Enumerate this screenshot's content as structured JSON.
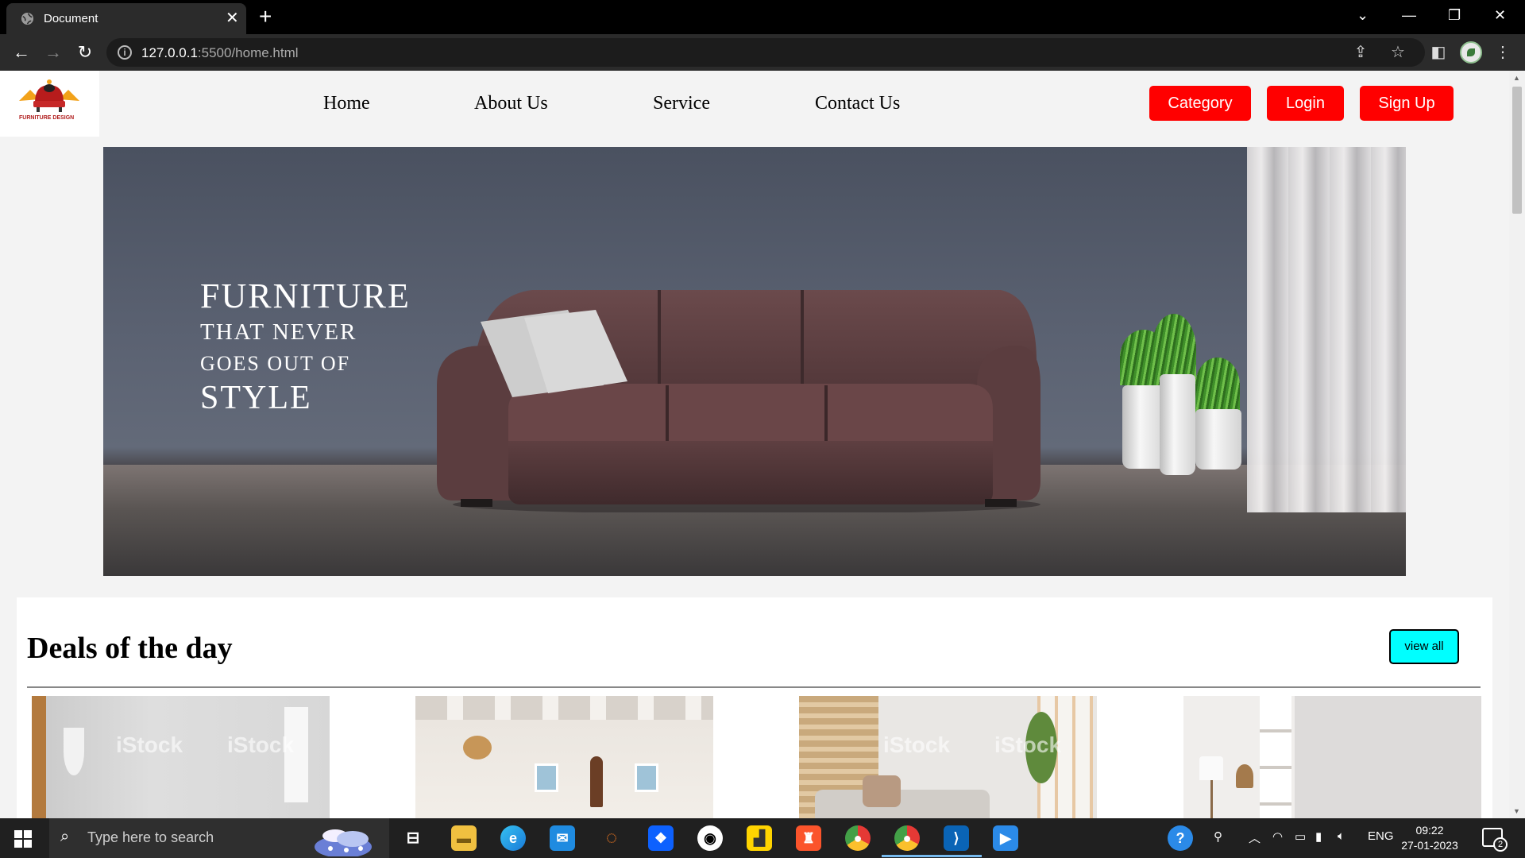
{
  "browser": {
    "tab_title": "Document",
    "tab_close": "✕",
    "new_tab": "+",
    "url_host": "127.0.0.1",
    "url_path": ":5500/home.html",
    "window_controls": [
      "⌄",
      "—",
      "❐",
      "✕"
    ]
  },
  "site": {
    "logo_text": "FURNITURE DESIGN",
    "nav": [
      "Home",
      "About Us",
      "Service",
      "Contact Us"
    ],
    "buttons": {
      "category": "Category",
      "login": "Login",
      "signup": "Sign Up"
    },
    "hero": {
      "line1": "FURNITURE",
      "line2": "THAT NEVER",
      "line3": "GOES OUT OF",
      "line4": "STYLE"
    },
    "deals": {
      "title": "Deals of the day",
      "view_all": "view all",
      "watermark": "iStock"
    }
  },
  "taskbar": {
    "search_placeholder": "Type here to search",
    "language": "ENG",
    "time": "09:22",
    "date": "27-01-2023",
    "notification_count": "2"
  },
  "colors": {
    "accent_red": "#ff0000",
    "view_all_cyan": "#00ffff",
    "chrome_dark": "#2b2b2b"
  }
}
